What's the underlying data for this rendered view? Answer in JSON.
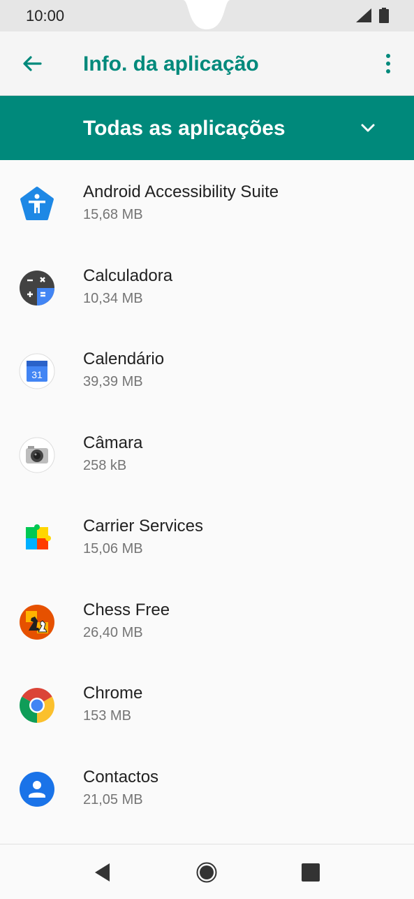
{
  "status": {
    "time": "10:00"
  },
  "header": {
    "title": "Info. da aplicação"
  },
  "filter": {
    "label": "Todas as aplicações"
  },
  "apps": [
    {
      "name": "Android Accessibility Suite",
      "size": "15,68 MB",
      "icon": "accessibility-icon"
    },
    {
      "name": "Calculadora",
      "size": "10,34 MB",
      "icon": "calculator-icon"
    },
    {
      "name": "Calendário",
      "size": "39,39 MB",
      "icon": "calendar-icon",
      "icon_text": "31"
    },
    {
      "name": "Câmara",
      "size": "258 kB",
      "icon": "camera-icon"
    },
    {
      "name": "Carrier Services",
      "size": "15,06 MB",
      "icon": "carrier-services-icon"
    },
    {
      "name": "Chess Free",
      "size": "26,40 MB",
      "icon": "chess-icon"
    },
    {
      "name": "Chrome",
      "size": "153 MB",
      "icon": "chrome-icon"
    },
    {
      "name": "Contactos",
      "size": "21,05 MB",
      "icon": "contacts-icon"
    }
  ],
  "colors": {
    "accent": "#00897b",
    "background": "#fafafa"
  }
}
